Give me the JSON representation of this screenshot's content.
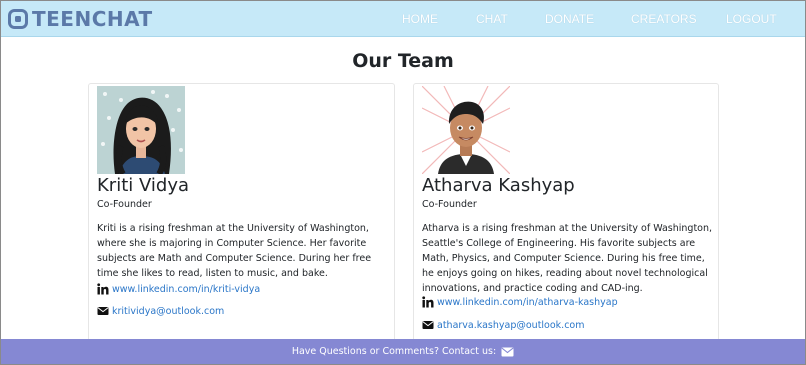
{
  "brand": {
    "name": "TEENCHAT",
    "icon": "rounded-square-logo-icon"
  },
  "nav": {
    "home": "HOME",
    "chat": "CHAT",
    "donate": "DONATE",
    "creators": "CREATORS",
    "logout": "LOGOUT"
  },
  "page": {
    "title": "Our Team"
  },
  "team": [
    {
      "name": "Kriti Vidya",
      "role": "Co-Founder",
      "bio": "Kriti is a rising freshman at the University of Washington, where she is majoring in Computer Science. Her favorite subjects are Math and Computer Science. During her free time she likes to read, listen to music, and bake.",
      "linkedin": "www.linkedin.com/in/kriti-vidya",
      "email": "kritividya@outlook.com",
      "avatar": "female-cartoon-avatar"
    },
    {
      "name": "Atharva Kashyap",
      "role": "Co-Founder",
      "bio": "Atharva is a rising freshman at the University of Washington, Seattle's College of Engineering. His favorite subjects are Math, Physics, and Computer Science. During his free time, he enjoys going on hikes, reading about novel technological innovations, and practice coding and CAD-ing.",
      "linkedin": "www.linkedin.com/in/atharva-kashyap",
      "email": "atharva.kashyap@outlook.com",
      "avatar": "male-cartoon-avatar"
    }
  ],
  "footer": {
    "text": "Have Questions or Comments? Contact us:",
    "icon": "envelope-icon"
  },
  "colors": {
    "navbar": "#c6e9f8",
    "brand": "#5b79a8",
    "footer": "#8588d3",
    "link": "#2a76c8"
  }
}
